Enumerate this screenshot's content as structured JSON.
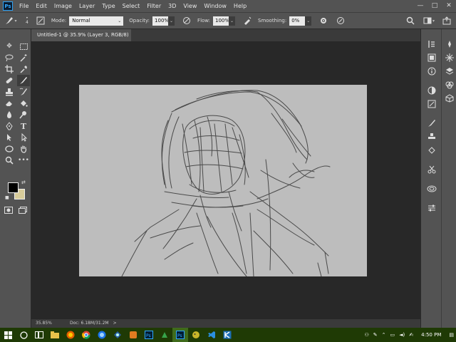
{
  "app": {
    "logo": "Ps",
    "menu": [
      "File",
      "Edit",
      "Image",
      "Layer",
      "Type",
      "Select",
      "Filter",
      "3D",
      "View",
      "Window",
      "Help"
    ],
    "window_controls": [
      "—",
      "□",
      "✕"
    ]
  },
  "options_bar": {
    "brush_size": "4",
    "mode_label": "Mode:",
    "mode_value": "Normal",
    "opacity_label": "Opacity:",
    "opacity_value": "100%",
    "flow_label": "Flow:",
    "flow_value": "100%",
    "smoothing_label": "Smoothing:",
    "smoothing_value": "0%"
  },
  "document": {
    "tab_title": "Untitled-1 @ 35.9% (Layer 3, RGB/8) *",
    "tab_close": "×"
  },
  "status": {
    "zoom": "35.85%",
    "doc_info": "Doc: 6.18M/31.2M",
    "arrow": ">"
  },
  "colors": {
    "foreground": "#000000",
    "background": "#d8cc9a",
    "ui_panel": "#535353",
    "pasteboard": "#282828",
    "canvas": "#bdbdbd",
    "taskbar": "#1f3a05"
  },
  "toolbar": {
    "icons": [
      "move-icon",
      "marquee-icon",
      "lasso-icon",
      "magic-wand-icon",
      "crop-icon",
      "eyedropper-icon",
      "healing-brush-icon",
      "brush-icon",
      "clone-stamp-icon",
      "history-brush-icon",
      "eraser-icon",
      "paint-bucket-icon",
      "blur-icon",
      "dodge-icon",
      "pen-icon",
      "type-icon",
      "path-select-icon",
      "hand-pointer-icon",
      "ellipse-icon",
      "hand-icon",
      "zoom-icon",
      "more-icon"
    ]
  },
  "taskbar": {
    "time": "4:50 PM",
    "icons": [
      "windows-start-icon",
      "search-icon",
      "task-view-icon",
      "file-explorer-icon",
      "firefox-icon",
      "chrome-icon",
      "firefox-blue-icon",
      "steam-icon",
      "app-orange-icon",
      "photoshop-icon",
      "app-green-icon",
      "photoshop-active-icon",
      "app-yellow-icon",
      "vscode-icon",
      "krita-icon"
    ]
  }
}
